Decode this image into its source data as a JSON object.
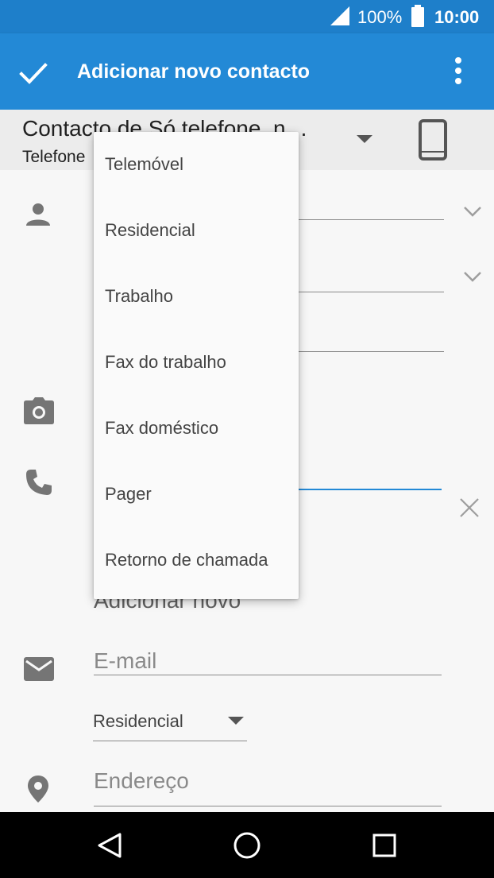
{
  "status_bar": {
    "battery": "100%",
    "time": "10:00"
  },
  "app_bar": {
    "title": "Adicionar novo contacto"
  },
  "account": {
    "name": "Contacto de Só telefone, n…",
    "subtitle": "Telefone"
  },
  "phone_section": {
    "add_new_label": "Adicionar novo"
  },
  "email_section": {
    "placeholder": "E-mail",
    "type_value": "Residencial"
  },
  "address_section": {
    "placeholder": "Endereço"
  },
  "type_menu": {
    "items": [
      {
        "label": "Telemóvel"
      },
      {
        "label": "Residencial"
      },
      {
        "label": "Trabalho"
      },
      {
        "label": "Fax do trabalho"
      },
      {
        "label": "Fax doméstico"
      },
      {
        "label": "Pager"
      },
      {
        "label": "Retorno de chamada"
      }
    ]
  },
  "colors": {
    "accent": "#2389d6",
    "status_bar": "#1e7fca",
    "icon_gray": "#757575"
  },
  "icons": {
    "confirm": "check-icon",
    "overflow": "more-vert-icon",
    "account_type": "smartphone-icon",
    "name": "person-icon",
    "photo": "camera-icon",
    "phone": "phone-icon",
    "email": "email-icon",
    "address": "location-icon",
    "clear": "close-icon"
  }
}
